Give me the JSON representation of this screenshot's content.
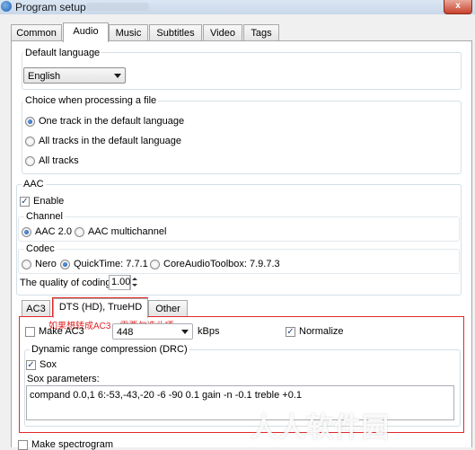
{
  "window": {
    "title": "Program setup",
    "close_label": "x"
  },
  "tabs": [
    {
      "label": "Common"
    },
    {
      "label": "Audio"
    },
    {
      "label": "Music"
    },
    {
      "label": "Subtitles"
    },
    {
      "label": "Video"
    },
    {
      "label": "Tags"
    }
  ],
  "default_language": {
    "group_label": "Default language",
    "selected": "English"
  },
  "processing": {
    "group_label": "Choice when processing a file",
    "options": [
      {
        "label": "One track in the default language",
        "selected": true
      },
      {
        "label": "All tracks in the default language",
        "selected": false
      },
      {
        "label": "All tracks",
        "selected": false
      }
    ]
  },
  "aac": {
    "group_label": "AAC",
    "enable_label": "Enable",
    "enable_checked": true,
    "channel": {
      "group_label": "Channel",
      "options": [
        {
          "label": "AAC 2.0",
          "selected": true
        },
        {
          "label": "AAC multichannel",
          "selected": false
        }
      ]
    },
    "codec": {
      "group_label": "Codec",
      "options": [
        {
          "label": "Nero",
          "selected": false
        },
        {
          "label": "QuickTime: 7.7.1",
          "selected": true
        },
        {
          "label": "CoreAudioToolbox: 7.9.7.3",
          "selected": false
        }
      ]
    },
    "quality_label": "The quality of coding",
    "quality_value": "1.00"
  },
  "subtabs": [
    {
      "label": "AC3"
    },
    {
      "label": "DTS (HD), TrueHD"
    },
    {
      "label": "Other"
    }
  ],
  "dts": {
    "annotation": "如果想转成AC3，需要勾选此项。",
    "make_ac3_label": "Make AC3",
    "make_ac3_checked": false,
    "bitrate": "448",
    "bitrate_unit": "kBps",
    "normalize_label": "Normalize",
    "normalize_checked": true,
    "drc": {
      "group_label": "Dynamic range compression (DRC)",
      "sox_label": "Sox",
      "sox_checked": true,
      "params_label": "Sox parameters:",
      "params_value": "compand 0.0,1 6:-53,-43,-20 -6 -90 0.1 gain -n -0.1 treble +0.1"
    }
  },
  "spectrogram_label": "Make spectrogram",
  "watermark": "人人软件园",
  "colors": {
    "annotation": "#e0282a",
    "accent": "#1b4f97"
  }
}
